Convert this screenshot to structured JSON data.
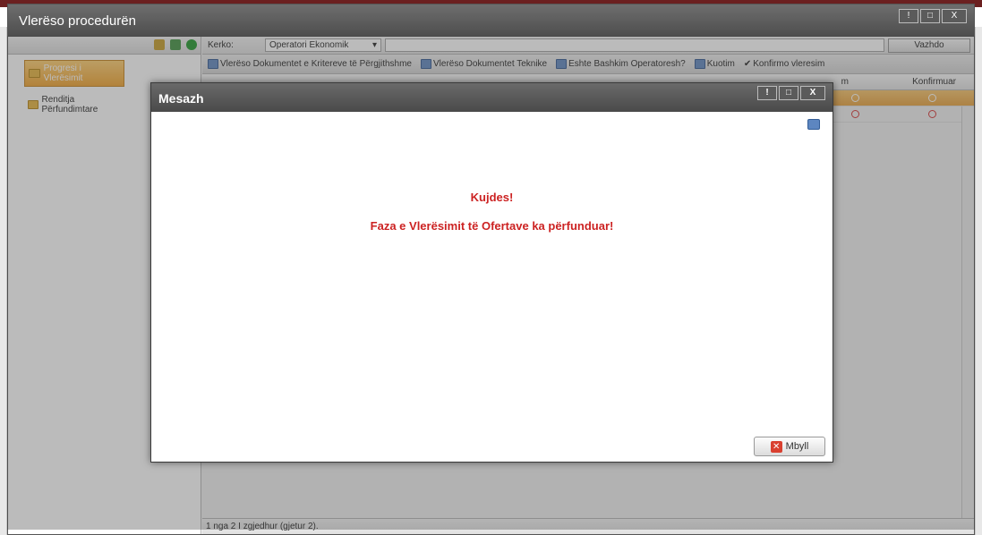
{
  "main_window": {
    "title": "Vlerëso procedurën",
    "title_buttons": [
      "!",
      "□",
      "X"
    ]
  },
  "tree": {
    "items": [
      {
        "label": "Progresi i Vlerësimit",
        "selected": true
      },
      {
        "label": "Renditja Përfundimtare",
        "selected": false
      }
    ]
  },
  "search": {
    "label": "Kerko:",
    "select_value": "Operatori Ekonomik",
    "button": "Vazhdo"
  },
  "actions": [
    {
      "label": "Vlerëso Dokumentet e Kritereve të Përgjithshme"
    },
    {
      "label": "Vlerëso Dokumentet Teknike"
    },
    {
      "label": "Eshte Bashkim Operatoresh?"
    },
    {
      "label": "Kuotim"
    },
    {
      "label": "Konfirmo vleresim"
    }
  ],
  "grid": {
    "col_partial": "m",
    "col_confirmed": "Konfirmuar"
  },
  "status_bar": "1 nga 2 I zgjedhur (gjetur 2).",
  "modal": {
    "title": "Mesazh",
    "title_buttons": [
      "!",
      "□",
      "X"
    ],
    "heading": "Kujdes!",
    "message": "Faza e Vlerësimit të Ofertave ka përfunduar!",
    "close_button": "Mbyll"
  },
  "colors": {
    "accent": "#f2a93b",
    "alert_text": "#cc2222",
    "titlebar": "#4d4d4d"
  }
}
